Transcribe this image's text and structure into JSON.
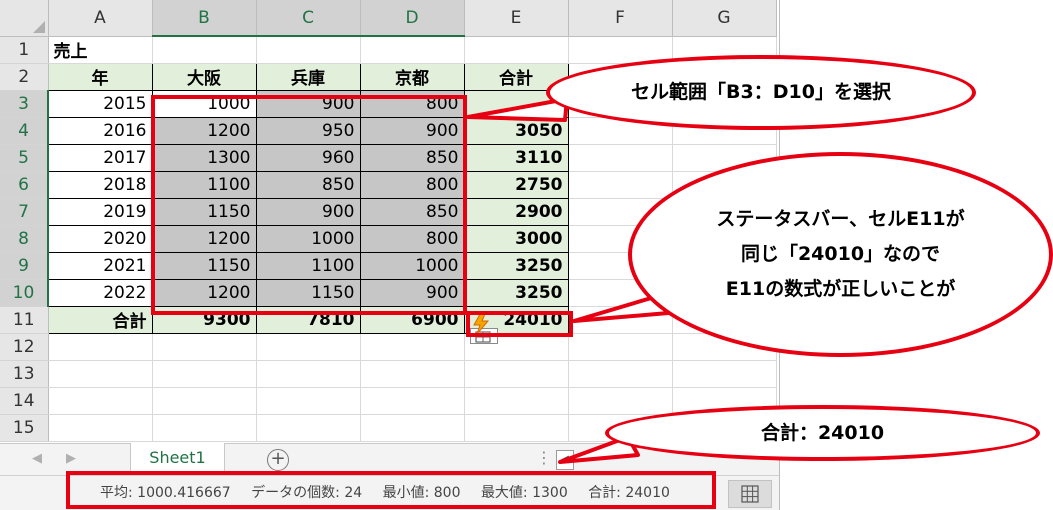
{
  "columns": [
    "A",
    "B",
    "C",
    "D",
    "E",
    "F",
    "G"
  ],
  "rows": [
    "1",
    "2",
    "3",
    "4",
    "5",
    "6",
    "7",
    "8",
    "9",
    "10",
    "11",
    "12",
    "13",
    "14",
    "15"
  ],
  "sheet": {
    "title": "売上",
    "headers": [
      "年",
      "大阪",
      "兵庫",
      "京都",
      "合計"
    ],
    "data": [
      [
        "2015",
        "1000",
        "900",
        "800",
        ""
      ],
      [
        "2016",
        "1200",
        "950",
        "900",
        "3050"
      ],
      [
        "2017",
        "1300",
        "960",
        "850",
        "3110"
      ],
      [
        "2018",
        "1100",
        "850",
        "800",
        "2750"
      ],
      [
        "2019",
        "1150",
        "900",
        "850",
        "2900"
      ],
      [
        "2020",
        "1200",
        "1000",
        "800",
        "3000"
      ],
      [
        "2021",
        "1150",
        "1100",
        "1000",
        "3250"
      ],
      [
        "2022",
        "1200",
        "1150",
        "900",
        "3250"
      ]
    ],
    "total": [
      "合計",
      "9300",
      "7810",
      "6900",
      "24010"
    ]
  },
  "tabs": {
    "sheet_name": "Sheet1",
    "add": "+",
    "left_arrow": "◀",
    "right_arrow": "▶",
    "dots": "⋮",
    "scroll_left": "◀"
  },
  "status": {
    "average": "平均: 1000.416667",
    "count": "データの個数: 24",
    "min": "最小値: 800",
    "max": "最大値: 1300",
    "sum": "合計: 24010"
  },
  "callouts": {
    "range": "セル範囲「B3：D10」を選択",
    "line1": "ステータスバー、セルE11が",
    "line2": "同じ「24010」なので",
    "line3": "E11の数式が正しいことが",
    "total": "合計：24010"
  },
  "colors": {
    "accent_red": "#e60012",
    "excel_green": "#217346",
    "header_fill": "#e2efda",
    "selection_gray": "#c6c6c6"
  },
  "icons": [
    "quick-analysis-icon",
    "normal-view-icon",
    "add-sheet-icon"
  ]
}
